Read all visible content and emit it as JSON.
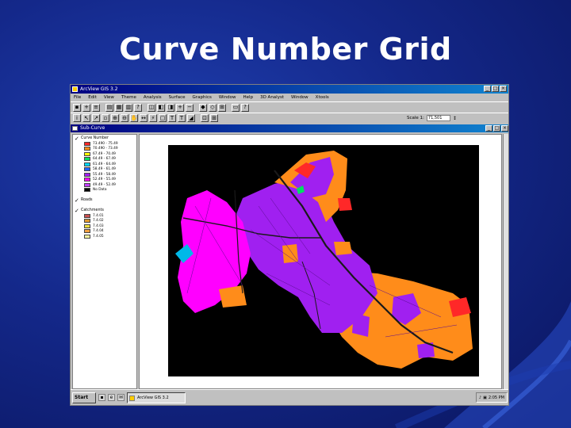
{
  "slide": {
    "title": "Curve Number Grid"
  },
  "app": {
    "title": "ArcView GIS 3.2",
    "menu": [
      "File",
      "Edit",
      "View",
      "Theme",
      "Analysis",
      "Surface",
      "Graphics",
      "Window",
      "Help",
      "3D Analyst",
      "Window",
      "Xtools"
    ],
    "scale_label": "Scale 1:",
    "scale_value": "71,501"
  },
  "view": {
    "title": "Sub-Curve",
    "themes": [
      {
        "name": "Curve Number",
        "checked": true,
        "legend": [
          {
            "label": "73.490 - 75.49",
            "color": "#ff2828"
          },
          {
            "label": "70.490 - 73.49",
            "color": "#ff8c1a"
          },
          {
            "label": "67.49 - 70.49",
            "color": "#ffff00"
          },
          {
            "label": "64.49 - 67.49",
            "color": "#00e060"
          },
          {
            "label": "61.49 - 64.49",
            "color": "#00d8ff"
          },
          {
            "label": "58.49 - 61.49",
            "color": "#2060ff"
          },
          {
            "label": "55.49 - 58.49",
            "color": "#a020f0"
          },
          {
            "label": "52.49 - 55.49",
            "color": "#ff00ff"
          },
          {
            "label": "49.49 - 52.49",
            "color": "#c040ff"
          },
          {
            "label": "No Data",
            "color": "#000000"
          }
        ]
      },
      {
        "name": "Roads",
        "checked": true,
        "legend": []
      },
      {
        "name": "Catchments",
        "checked": true,
        "legend": [
          {
            "label": "7.4.01",
            "color": "#c85050"
          },
          {
            "label": "7.4.02",
            "color": "#e09a30"
          },
          {
            "label": "7.4.03",
            "color": "#f0e040"
          },
          {
            "label": "7.4.04",
            "color": "#f0a040"
          },
          {
            "label": "7.4.05",
            "color": "#f8f8a0"
          }
        ]
      }
    ]
  },
  "taskbar": {
    "start_label": "Start",
    "task_label": "ArcView GIS 3.2",
    "clock": "2:05 PM"
  },
  "colors": {
    "background": "#000000",
    "purple": "#a020f0",
    "orange": "#ff8c1a",
    "magenta": "#ff00ff",
    "red": "#ff2828",
    "cyan": "#00b8e8",
    "green": "#00e060",
    "road": "#1a1a1a"
  }
}
